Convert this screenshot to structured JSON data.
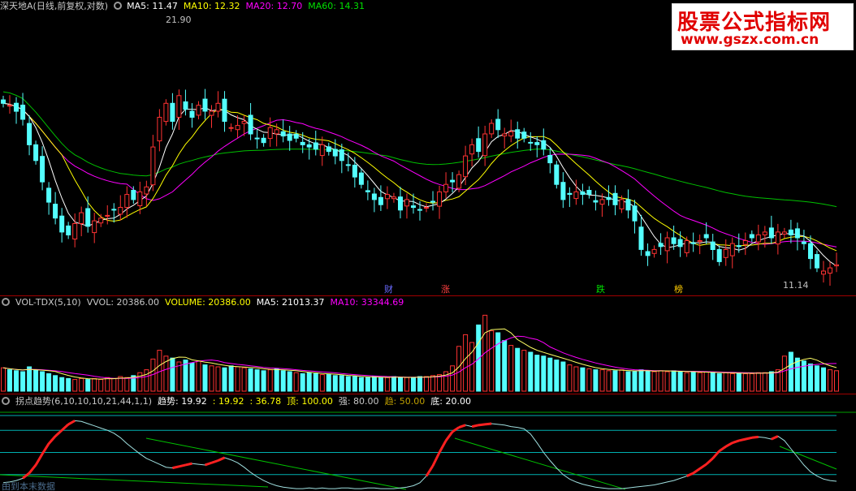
{
  "main_header": {
    "stock_title": "深天地A(日线,前复权,对数)",
    "ma5": "MA5: 11.47",
    "ma10": "MA10: 12.32",
    "ma20": "MA20: 12.70",
    "ma60": "MA60: 14.31"
  },
  "price_annotations": {
    "high": "21.90",
    "low": "11.14"
  },
  "events": [
    "财",
    "涨",
    "跌",
    "榜"
  ],
  "volume_header": {
    "name": "VOL-TDX(5,10)",
    "vvol": "VVOL: 20386.00",
    "volume": "VOLUME: 20386.00",
    "ma5": "MA5: 21013.37",
    "ma10": "MA10: 33344.69"
  },
  "indicator_header": {
    "name": "拐点趋势(6,10,10,10,21,44,1,1)",
    "trend": "趋势: 19.92",
    "v2": ": 19.92",
    "v3": ": 36.78",
    "top": "顶: 100.00",
    "strong": "强: 80.00",
    "trend2": "趋: 50.00",
    "bottom": "底: 20.00"
  },
  "watermark": {
    "line1": "股票公式指标网",
    "line2": "www.gszx.com.cn"
  },
  "bottom_label": "由到本末数据",
  "colors": {
    "up": "#ff3232",
    "down": "#54ffff",
    "ma5": "#ffffff",
    "ma10": "#ffff00",
    "ma20": "#ff00ff",
    "ma60": "#00c000",
    "separator": "#a00000"
  },
  "chart_data": {
    "type": "candlestick",
    "title": "深天地A(日线,前复权,对数)",
    "price_anchors": [
      21.9,
      11.14
    ],
    "ma_latest": {
      "MA5": 11.47,
      "MA10": 12.32,
      "MA20": 12.7,
      "MA60": 14.31
    },
    "volume_latest": {
      "VVOL": 20386.0,
      "VOLUME": 20386.0,
      "MA5": 21013.37,
      "MA10": 33344.69
    },
    "indicator_levels": {
      "顶": 100.0,
      "强": 80.0,
      "趋": 50.0,
      "底": 20.0
    },
    "closes": [
      17.6,
      17.5,
      17.2,
      16.8,
      15.6,
      14.9,
      14.0,
      13.2,
      12.6,
      12.1,
      12.0,
      12.4,
      12.8,
      12.3,
      12.5,
      12.6,
      12.7,
      12.9,
      13.0,
      13.5,
      13.3,
      13.6,
      13.8,
      15.5,
      16.9,
      17.6,
      16.7,
      18.0,
      17.3,
      16.9,
      17.5,
      17.2,
      17.2,
      17.6,
      16.7,
      16.4,
      16.5,
      16.7,
      16.1,
      15.9,
      15.7,
      16.4,
      16.3,
      16.0,
      15.8,
      15.9,
      15.6,
      15.5,
      15.4,
      15.6,
      15.3,
      15.1,
      14.9,
      14.7,
      14.2,
      13.9,
      13.6,
      13.3,
      13.1,
      13.5,
      13.4,
      12.9,
      13.3,
      13.0,
      12.9,
      13.0,
      13.2,
      13.6,
      13.9,
      14.0,
      14.3,
      15.1,
      15.6,
      15.3,
      16.1,
      16.6,
      16.3,
      16.1,
      16.2,
      15.9,
      15.9,
      15.7,
      15.6,
      15.4,
      14.8,
      13.9,
      13.3,
      13.5,
      13.6,
      13.5,
      13.5,
      13.2,
      13.3,
      13.3,
      13.1,
      13.3,
      12.9,
      12.5,
      11.5,
      11.3,
      11.5,
      11.6,
      11.9,
      11.7,
      11.6,
      11.8,
      11.7,
      11.8,
      11.9,
      11.5,
      11.1,
      11.5,
      11.7,
      11.6,
      11.8,
      11.9,
      12.0,
      12.1,
      11.9,
      12.1,
      12.1,
      12.0,
      11.9,
      11.7,
      11.2,
      10.9,
      10.8,
      10.9,
      11.0
    ],
    "volumes": [
      24,
      22,
      21,
      20,
      25,
      22,
      20,
      18,
      16,
      14,
      13,
      12,
      13,
      12,
      13,
      12,
      14,
      13,
      15,
      14,
      16,
      19,
      22,
      33,
      42,
      36,
      34,
      30,
      32,
      29,
      31,
      27,
      26,
      25,
      24,
      26,
      25,
      24,
      23,
      22,
      21,
      22,
      23,
      21,
      20,
      19,
      18,
      19,
      18,
      17,
      17,
      16,
      16,
      15,
      15,
      14,
      14,
      15,
      14,
      14,
      15,
      14,
      14,
      14,
      15,
      15,
      16,
      17,
      20,
      26,
      46,
      58,
      50,
      68,
      78,
      62,
      60,
      52,
      47,
      44,
      42,
      40,
      37,
      36,
      34,
      32,
      30,
      27,
      25,
      24,
      23,
      22,
      22,
      21,
      21,
      22,
      20,
      20,
      22,
      21,
      20,
      21,
      20,
      21,
      20,
      19,
      20,
      19,
      20,
      19,
      18,
      19,
      18,
      19,
      18,
      18,
      19,
      19,
      20,
      22,
      36,
      40,
      34,
      31,
      28,
      26,
      24,
      22,
      21
    ],
    "trend_line": [
      9,
      10,
      12,
      15,
      22,
      33,
      48,
      62,
      72,
      80,
      88,
      93,
      92,
      89,
      86,
      83,
      80,
      76,
      70,
      62,
      55,
      48,
      42,
      38,
      34,
      30,
      29,
      31,
      33,
      35,
      34,
      33,
      36,
      39,
      43,
      40,
      36,
      30,
      23,
      17,
      12,
      8,
      5,
      3,
      2,
      1,
      1,
      2,
      1,
      2,
      1,
      1,
      2,
      2,
      1,
      1,
      2,
      2,
      1,
      1,
      1,
      2,
      3,
      5,
      9,
      18,
      32,
      50,
      66,
      78,
      84,
      87,
      85,
      87,
      88,
      89,
      88,
      87,
      85,
      84,
      82,
      75,
      63,
      50,
      39,
      29,
      20,
      14,
      10,
      7,
      5,
      3,
      2,
      1,
      1,
      1,
      2,
      3,
      4,
      5,
      6,
      8,
      10,
      12,
      15,
      18,
      22,
      28,
      34,
      42,
      52,
      58,
      63,
      66,
      68,
      70,
      71,
      70,
      68,
      72,
      66,
      55,
      44,
      33,
      24,
      18,
      14,
      12,
      11
    ]
  }
}
